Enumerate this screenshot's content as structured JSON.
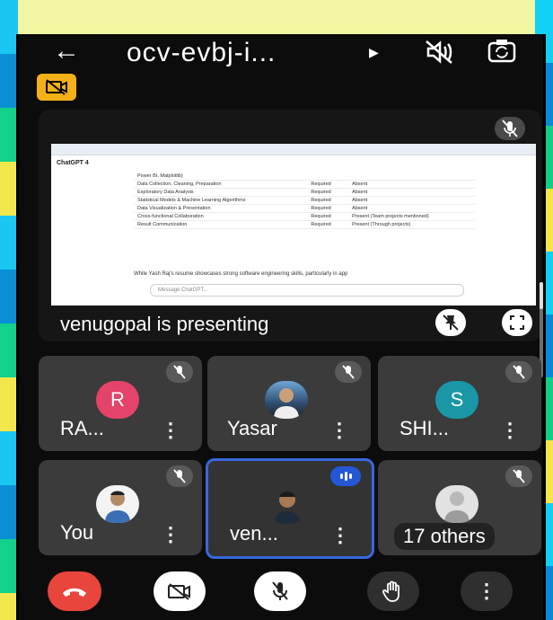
{
  "header": {
    "meeting_title": "ocv-evbj-i...",
    "back_icon": "back-arrow-icon",
    "caret_icon": "caret-right-icon",
    "speaker_icon": "speaker-off-icon",
    "switch_camera_icon": "switch-camera-icon"
  },
  "badge": {
    "icon": "camera-off-icon",
    "color": "#f3b117"
  },
  "presentation": {
    "label": "venugopal is presenting",
    "screen": {
      "app_name": "ChatGPT 4",
      "rows": [
        [
          "Power BI, Matplotlib)",
          "",
          ""
        ],
        [
          "Data Collection, Cleaning, Preparation",
          "Required",
          "Absent"
        ],
        [
          "Exploratory Data Analysis",
          "Required",
          "Absent"
        ],
        [
          "Statistical Models & Machine Learning Algorithms",
          "Required",
          "Absent"
        ],
        [
          "Data Visualization & Presentation",
          "Required",
          "Absent"
        ],
        [
          "Cross-functional Collaboration",
          "Required",
          "Present (Team projects mentioned)"
        ],
        [
          "Result Communication",
          "Required",
          "Present (Through projects)"
        ]
      ],
      "paragraph": "While Yash Raj's resume showcases strong software engineering skills, particularly in app",
      "input_placeholder": "Message ChatGPT..."
    }
  },
  "participants": [
    {
      "name": "RA...",
      "initial": "R",
      "avatar_color": "#e4446a",
      "type": "initial"
    },
    {
      "name": "Yasar",
      "type": "photo"
    },
    {
      "name": "SHI...",
      "initial": "S",
      "avatar_color": "#1a97a6",
      "type": "initial"
    },
    {
      "name": "You",
      "type": "photo"
    },
    {
      "name": "ven...",
      "type": "photo",
      "speaking": true
    },
    {
      "name": "17 others",
      "type": "photo"
    }
  ],
  "controls": {
    "end_call_color": "#e8453c",
    "end_call_icon": "phone-hangup-icon",
    "camera_icon": "camera-off-icon",
    "mic_icon": "mic-off-icon",
    "hand_icon": "raise-hand-icon",
    "more_label": "⋮"
  },
  "accent": "#2457d6"
}
